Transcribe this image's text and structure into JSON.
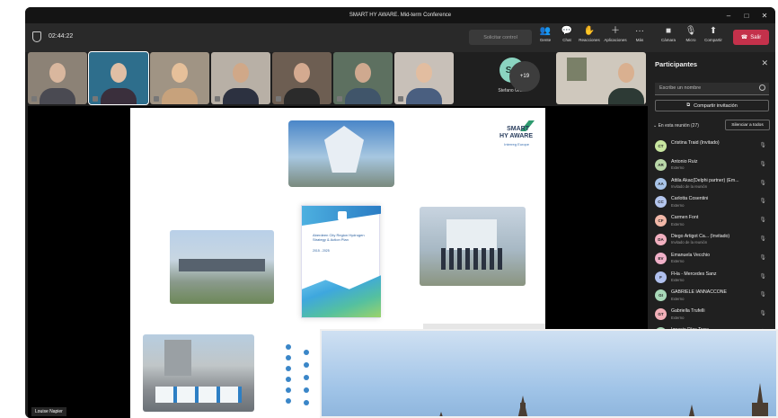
{
  "window": {
    "title": "SMART HY AWARE. Mid-term Conference"
  },
  "toolbar": {
    "timer": "02:44:22",
    "request_control": "Solicitar control",
    "buttons": [
      {
        "label": "Gente",
        "icon": "people-icon"
      },
      {
        "label": "Chat",
        "icon": "chat-icon"
      },
      {
        "label": "Reacciones",
        "icon": "reactions-icon"
      },
      {
        "label": "Aplicaciones",
        "icon": "apps-icon"
      },
      {
        "label": "Más",
        "icon": "more-icon"
      },
      {
        "label": "Cámara",
        "icon": "camera-icon"
      },
      {
        "label": "Micro",
        "icon": "mic-icon"
      },
      {
        "label": "Compartir",
        "icon": "share-icon"
      }
    ],
    "leave": "Salir"
  },
  "video_strip": {
    "avatar_initials": "SG",
    "avatar_name": "Stefano Gra...",
    "overflow_count": "+19"
  },
  "presenter": "Louise Napier",
  "slide": {
    "logo_line1": "SMART",
    "logo_line2": "HY AWARE",
    "logo_sub": "Interreg Europe",
    "brochure_title": "Aberdeen City Region Hydrogen Strategy & Action Plan",
    "brochure_years": "2015 - 2025"
  },
  "panel": {
    "title": "Participantes",
    "search_placeholder": "Escribe un nombre",
    "invite_label": "Compartir invitación",
    "in_meeting": "En esta reunión (27)",
    "mute_all": "Silenciar a todos",
    "participants": [
      {
        "initials": "CT",
        "name": "Cristina Traid (Invitado)",
        "role": "",
        "color": "#c8e6a0"
      },
      {
        "initials": "AR",
        "name": "Antonio Ruiz",
        "role": "Externo",
        "color": "#b9d7a8"
      },
      {
        "initials": "AA",
        "name": "Attila Akac(Delphi partner) (Em...",
        "role": "Invitado de la reunión",
        "color": "#a8c4e8"
      },
      {
        "initials": "CC",
        "name": "Carlotta Cosentini",
        "role": "Externo",
        "color": "#b4c6ee"
      },
      {
        "initials": "CF",
        "name": "Carmen Font",
        "role": "Externo",
        "color": "#f2b8a8"
      },
      {
        "initials": "DA",
        "name": "Diego Artigot Ca... (Invitado)",
        "role": "Invitado de la reunión",
        "color": "#f2b0c0"
      },
      {
        "initials": "EV",
        "name": "Emanuela Vecchio",
        "role": "Externo",
        "color": "#f0b0c8"
      },
      {
        "initials": "F",
        "name": "FHa - Mercedes Sanz",
        "role": "Externo",
        "color": "#b0c0ee"
      },
      {
        "initials": "GI",
        "name": "GABRIELE IANNACCONE",
        "role": "Externo",
        "color": "#a8d8b8"
      },
      {
        "initials": "GT",
        "name": "Gabriella Trufelli",
        "role": "Externo",
        "color": "#f2b0b8"
      },
      {
        "initials": "IR",
        "name": "Ignacio Ríos Torre",
        "role": "",
        "color": "#a8d8b8"
      }
    ]
  }
}
